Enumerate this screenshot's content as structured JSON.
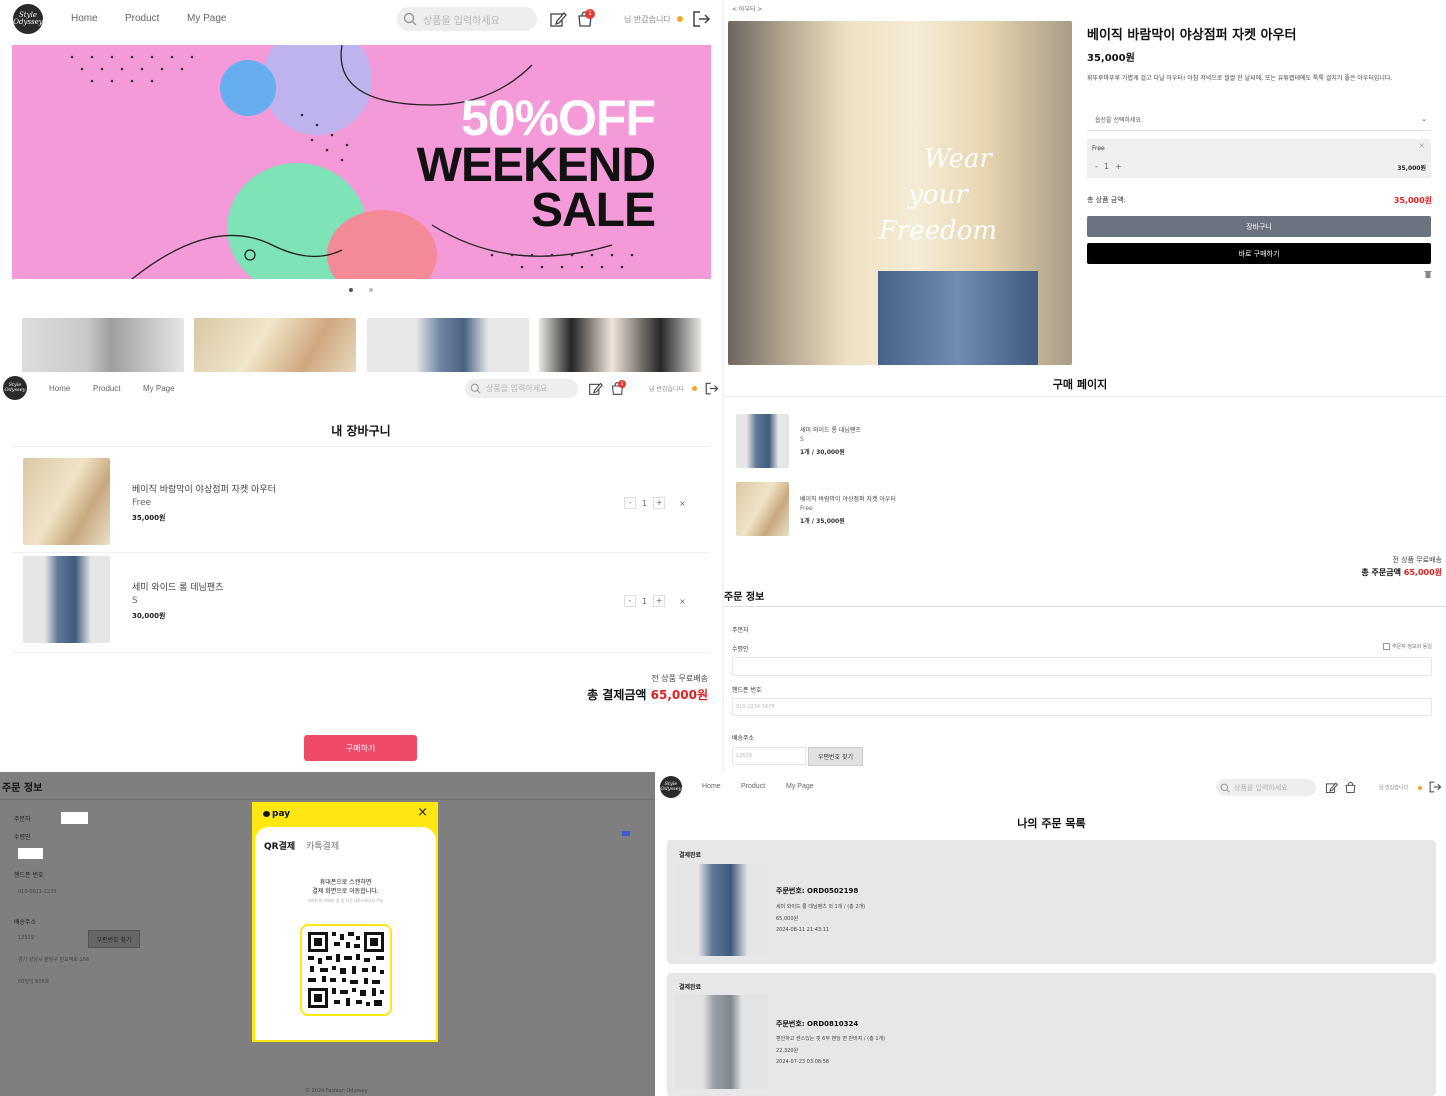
{
  "nav": {
    "logo_text": "Style Odyssey",
    "home": "Home",
    "product": "Product",
    "mypage": "My Page",
    "search_placeholder": "상품을 입력하세요",
    "cart_badge": "1",
    "greeting": "님 반갑습니다"
  },
  "banner": {
    "line1": "50%OFF",
    "line2": "WEEKEND",
    "line3": "SALE",
    "colors": {
      "bg": "#f49ad8",
      "blob_green": "#7ee3b6",
      "blob_blue": "#66aef0",
      "blob_lavender": "#b8b6f0",
      "blob_coral": "#f48a97"
    }
  },
  "product_detail": {
    "breadcrumb": "< 아우터 >",
    "image_text": [
      "Wear",
      "your",
      "Freedom"
    ],
    "title": "베이직 바람막이 야상점퍼 자켓 아우터",
    "price": "35,000원",
    "description": "휘뚜루마뚜루 가볍게 걸고 다닐 아우터! 아침 저녁으로 쌀쌀 한 날씨에, 또는 유튜랩테에도 툭툭 걸치기 좋은 아우터입니다.",
    "option_placeholder": "옵션을 선택하세요.",
    "selected_option": "Free",
    "selected_qty": "1",
    "selected_price": "35,000원",
    "total_label": "총 상품 금액:",
    "total_value": "35,000원",
    "cart_button": "장바구니",
    "buy_button": "바로 구매하기"
  },
  "cart": {
    "title": "내 장바구니",
    "items": [
      {
        "name": "베이직 바람막이 야상점퍼 자켓 아우터",
        "option": "Free",
        "price": "35,000원",
        "qty": "1"
      },
      {
        "name": "세미 와이드 롱 데님팬츠",
        "option": "S",
        "price": "30,000원",
        "qty": "1"
      }
    ],
    "shipping_note": "전 상품 무료배송",
    "total_label": "총 결제금액",
    "total_value": "65,000원",
    "checkout_button": "구매하기"
  },
  "purchase": {
    "title": "구매 페이지",
    "items": [
      {
        "name": "세미 와이드 롱 데님팬츠",
        "option": "S",
        "line": "1개 / 30,000원"
      },
      {
        "name": "베이직 바람막이 야상점퍼 자켓 아우터",
        "option": "Free",
        "line": "1개 / 35,000원"
      }
    ],
    "shipping_note": "전 상품 무료배송",
    "total_label": "총 주문금액",
    "total_value": "65,000원",
    "order_info_title": "주문 정보",
    "orderer_label": "주문자",
    "recipient_label": "수령인",
    "same_checkbox": "주문자 정보와 동일",
    "phone_label": "핸드폰 번호",
    "phone_placeholder": "010-1234-5678",
    "address_label": "배송주소",
    "zip_placeholder": "13529",
    "zip_button": "우편번호 찾기"
  },
  "payment_modal": {
    "order_info_title": "주문 정보",
    "orderer_label": "주문자",
    "recipient_label": "수령인",
    "phone_label": "핸드폰 번호",
    "phone_value": "010-0011-2233",
    "address_label": "배송주소",
    "zip_value": "13529",
    "zip_button": "우편번호 찾기",
    "address_value": "경기 성남시 분당구 판교역로 166",
    "detail_address": "00빌딩 808호",
    "footer": "© 2024 Fashion Odyssey",
    "pay_brand": "pay",
    "tab_qr": "QR결제",
    "tab_talk": "카톡결제",
    "message_line1": "휴대폰으로 스캔하면",
    "message_line2": "결제 화면으로 이동합니다.",
    "message_sub": "스마트폰 카메라 앱 및 모든 QR스캐너로 가능",
    "colors": {
      "yellow": "#ffe812"
    }
  },
  "orders": {
    "title": "나의 주문 목록",
    "items": [
      {
        "status": "결제완료",
        "order_no": "주문번호: ORD0502198",
        "desc": "세미 와이드 롱 데님팬츠 외 1개 / (총 2개)",
        "amount": "65,000원",
        "date": "2024-08-11 21:43:11"
      },
      {
        "status": "결제완료",
        "order_no": "주문번호: ORD0810324",
        "desc": "편안하고 센스있는 핏 6부 밴딩 면 반바지 / (총 1개)",
        "amount": "22,320원",
        "date": "2024-07-23 03:08:58"
      }
    ]
  },
  "accent": {
    "red": "#e02020",
    "pink_button": "#f04a6a",
    "gray_button": "#6b7280"
  }
}
